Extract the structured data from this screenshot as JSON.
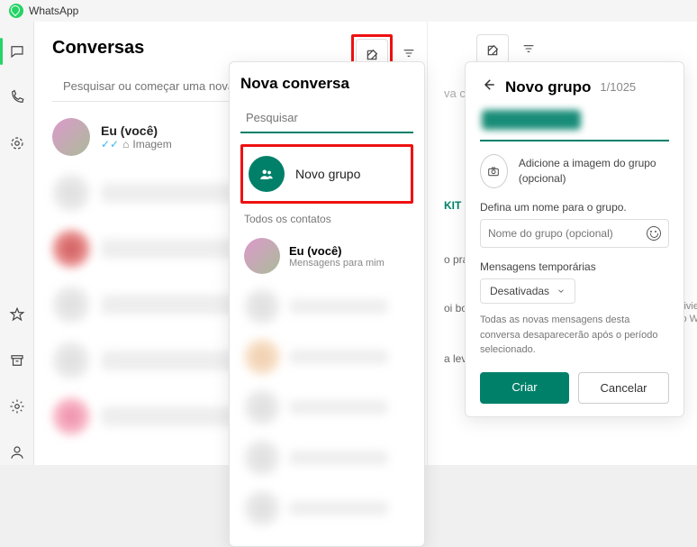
{
  "app": {
    "title": "WhatsApp"
  },
  "col1": {
    "heading": "Conversas",
    "search_placeholder": "Pesquisar ou começar uma nova conversa",
    "self": {
      "name": "Eu (você)",
      "subtitle": "Imagem"
    }
  },
  "panel_nc": {
    "title": "Nova conversa",
    "search_placeholder": "Pesquisar",
    "new_group": "Novo grupo",
    "section": "Todos os contatos",
    "self": {
      "name": "Eu (você)",
      "subtitle": "Mensagens para mim"
    }
  },
  "col2": {
    "search_hint": "va conve",
    "snips": [
      "KIT GR",
      "o pra cas",
      "oi boa",
      "a levar."
    ],
    "side": [
      "ivie",
      "o W"
    ]
  },
  "panel_ng": {
    "title": "Novo grupo",
    "count": "1/1025",
    "add_image": "Adicione a imagem do grupo (opcional)",
    "name_label": "Defina um nome para o grupo.",
    "name_placeholder": "Nome do grupo (opcional)",
    "tm_label": "Mensagens temporárias",
    "tm_value": "Desativadas",
    "desc": "Todas as novas mensagens desta conversa desaparecerão após o período selecionado.",
    "create": "Criar",
    "cancel": "Cancelar"
  }
}
